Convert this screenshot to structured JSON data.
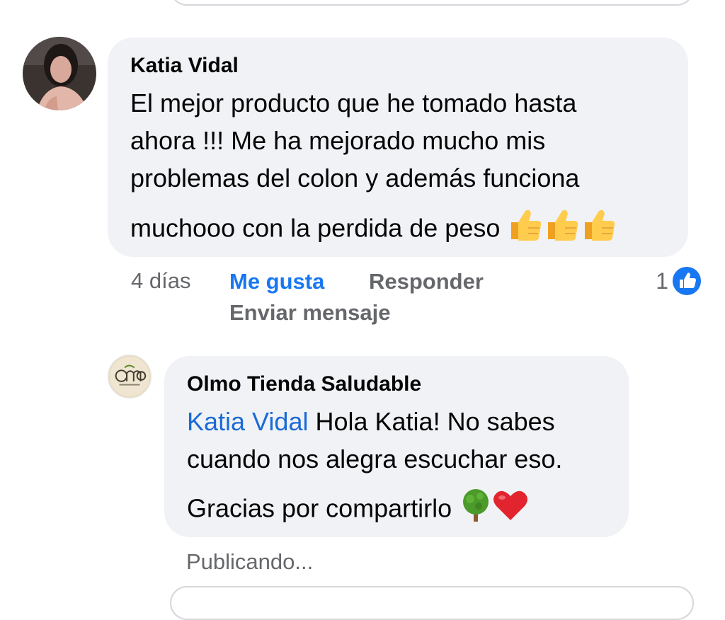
{
  "comment": {
    "author": "Katia Vidal",
    "lines": [
      "El mejor producto que he tomado hasta",
      "ahora !!!  Me ha mejorado mucho mis",
      "problemas del colon y además funciona",
      "muchooo con la perdida de peso"
    ],
    "emoji": "thumbs-up x3",
    "time": "4 días",
    "like_label": "Me gusta",
    "reply_label": "Responder",
    "message_label": "Enviar mensaje",
    "reaction_count": "1",
    "reaction_icon": "like-icon"
  },
  "reply": {
    "author": "Olmo Tienda Saludable",
    "mention": "Katia Vidal",
    "line1_rest": " Hola Katia! No sabes",
    "line2": "cuando nos alegra escuchar eso.",
    "line3": "Gracias por compartirlo",
    "emoji": "tree, red-heart",
    "status": "Publicando..."
  },
  "colors": {
    "link_blue": "#1877f2",
    "bubble_bg": "#f0f2f5",
    "meta_gray": "#65676b"
  }
}
